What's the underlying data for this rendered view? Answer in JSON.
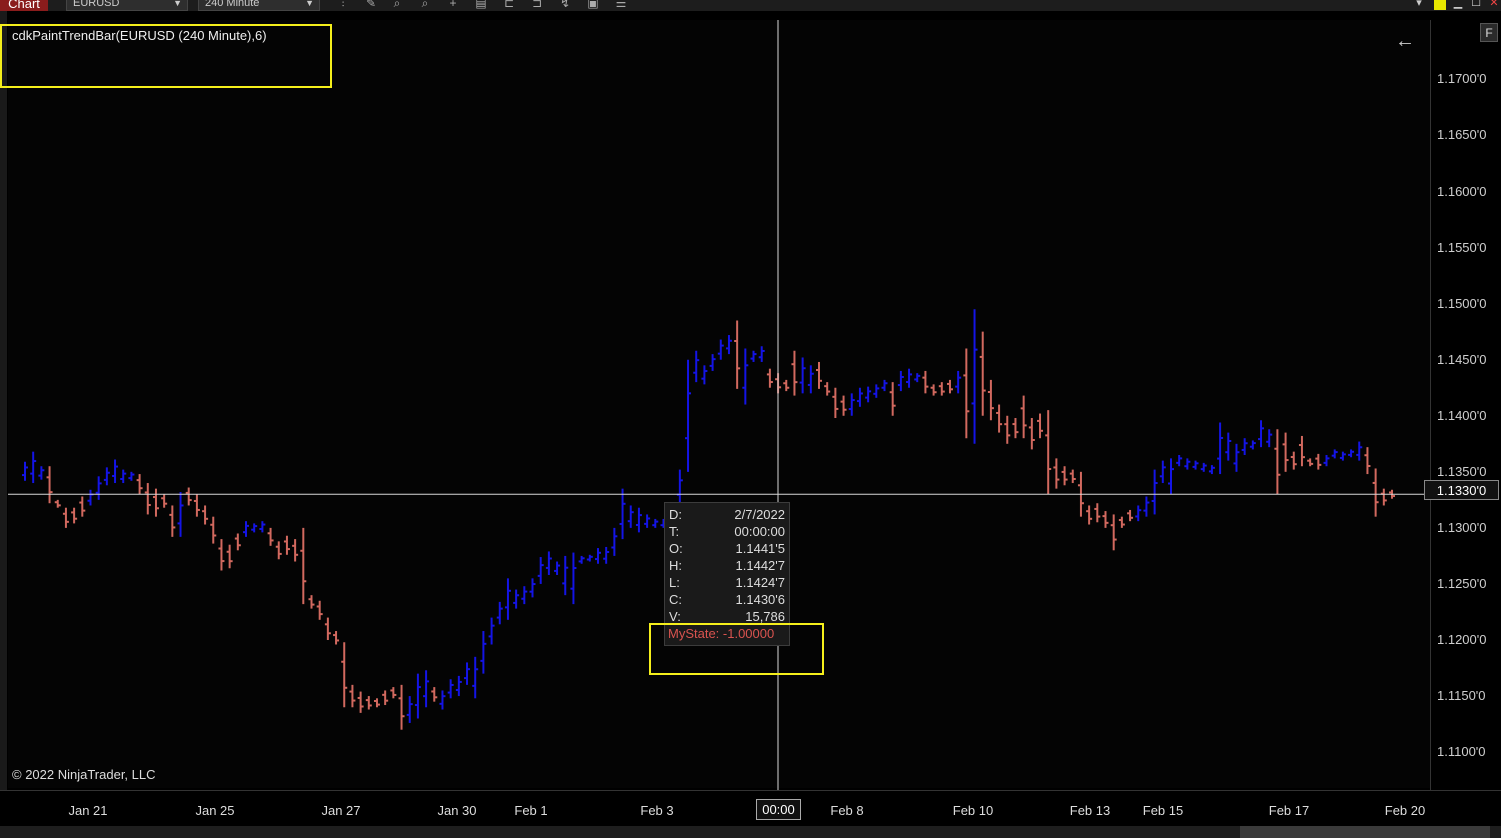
{
  "toolbar": {
    "chart_tab": "Chart",
    "instrument": "EURUSD",
    "interval": "240 Minute"
  },
  "indicator_label": "cdkPaintTrendBar(EURUSD (240 Minute),6)",
  "copyright": "© 2022 NinjaTrader, LLC",
  "f_button": "F",
  "price_badge": "1.1330'0",
  "time_badge": "00:00",
  "tooltip": {
    "rows": [
      {
        "k": "D:",
        "v": "2/7/2022"
      },
      {
        "k": "T:",
        "v": "00:00:00"
      },
      {
        "k": "O:",
        "v": "1.1441'5"
      },
      {
        "k": "H:",
        "v": "1.1442'7"
      },
      {
        "k": "L:",
        "v": "1.1424'7"
      },
      {
        "k": "C:",
        "v": "1.1430'6"
      },
      {
        "k": "V:",
        "v": "15,786"
      }
    ],
    "state": "MyState: -1.00000"
  },
  "colors": {
    "up": "#1414e6",
    "down": "#d2695f",
    "crosshair": "#d8d8d8",
    "highlight": "#f5ef1b"
  },
  "chart_data": {
    "type": "ohlc",
    "instrument": "EURUSD",
    "interval": "240 Minute",
    "y_tick_labels": [
      "1.1700'0",
      "1.1650'0",
      "1.1600'0",
      "1.1550'0",
      "1.1500'0",
      "1.1450'0",
      "1.1400'0",
      "1.1350'0",
      "1.1300'0",
      "1.1250'0",
      "1.1200'0",
      "1.1150'0",
      "1.1100'0"
    ],
    "y_tick_values": [
      1.17,
      1.165,
      1.16,
      1.155,
      1.15,
      1.145,
      1.14,
      1.135,
      1.13,
      1.125,
      1.12,
      1.115,
      1.11
    ],
    "x_tick_labels": [
      "Jan 21",
      "Jan 25",
      "Jan 27",
      "Jan 30",
      "Feb 1",
      "Feb 3",
      "Feb 8",
      "Feb 10",
      "Feb 13",
      "Feb 15",
      "Feb 17",
      "Feb 20"
    ],
    "crosshair_price": 1.133,
    "ylim": [
      1.1068,
      1.1753
    ],
    "bars": [
      {
        "c": "u",
        "h": 1.1359,
        "l": 1.1342
      },
      {
        "c": "u",
        "h": 1.1368,
        "l": 1.134
      },
      {
        "c": "u",
        "h": 1.1355,
        "l": 1.1343
      },
      {
        "c": "d",
        "h": 1.1355,
        "l": 1.1322
      },
      {
        "c": "d",
        "h": 1.1325,
        "l": 1.1318
      },
      {
        "c": "d",
        "h": 1.1318,
        "l": 1.13
      },
      {
        "c": "d",
        "h": 1.1318,
        "l": 1.1304
      },
      {
        "c": "d",
        "h": 1.1328,
        "l": 1.131
      },
      {
        "c": "u",
        "h": 1.1334,
        "l": 1.132
      },
      {
        "c": "u",
        "h": 1.1346,
        "l": 1.1325
      },
      {
        "c": "u",
        "h": 1.1354,
        "l": 1.1338
      },
      {
        "c": "u",
        "h": 1.1361,
        "l": 1.134
      },
      {
        "c": "u",
        "h": 1.1352,
        "l": 1.134
      },
      {
        "c": "u",
        "h": 1.135,
        "l": 1.1342
      },
      {
        "c": "d",
        "h": 1.1348,
        "l": 1.133
      },
      {
        "c": "d",
        "h": 1.134,
        "l": 1.1312
      },
      {
        "c": "d",
        "h": 1.1335,
        "l": 1.131
      },
      {
        "c": "d",
        "h": 1.133,
        "l": 1.1318
      },
      {
        "c": "d",
        "h": 1.132,
        "l": 1.1292
      },
      {
        "c": "u",
        "h": 1.1332,
        "l": 1.1292
      },
      {
        "c": "d",
        "h": 1.1336,
        "l": 1.132
      },
      {
        "c": "d",
        "h": 1.133,
        "l": 1.131
      },
      {
        "c": "d",
        "h": 1.132,
        "l": 1.1303
      },
      {
        "c": "d",
        "h": 1.131,
        "l": 1.1286
      },
      {
        "c": "d",
        "h": 1.129,
        "l": 1.1262
      },
      {
        "c": "d",
        "h": 1.1285,
        "l": 1.1264
      },
      {
        "c": "d",
        "h": 1.1295,
        "l": 1.128
      },
      {
        "c": "u",
        "h": 1.1306,
        "l": 1.1292
      },
      {
        "c": "u",
        "h": 1.1304,
        "l": 1.1296
      },
      {
        "c": "u",
        "h": 1.1306,
        "l": 1.1296
      },
      {
        "c": "d",
        "h": 1.13,
        "l": 1.1284
      },
      {
        "c": "d",
        "h": 1.1288,
        "l": 1.1272
      },
      {
        "c": "d",
        "h": 1.1293,
        "l": 1.1276
      },
      {
        "c": "d",
        "h": 1.129,
        "l": 1.127
      },
      {
        "c": "d",
        "h": 1.13,
        "l": 1.1232
      },
      {
        "c": "d",
        "h": 1.124,
        "l": 1.1228
      },
      {
        "c": "d",
        "h": 1.1235,
        "l": 1.1218
      },
      {
        "c": "d",
        "h": 1.122,
        "l": 1.12
      },
      {
        "c": "d",
        "h": 1.1208,
        "l": 1.1196
      },
      {
        "c": "d",
        "h": 1.1198,
        "l": 1.114
      },
      {
        "c": "d",
        "h": 1.116,
        "l": 1.114
      },
      {
        "c": "d",
        "h": 1.1154,
        "l": 1.1135
      },
      {
        "c": "d",
        "h": 1.115,
        "l": 1.1138
      },
      {
        "c": "d",
        "h": 1.1148,
        "l": 1.114
      },
      {
        "c": "d",
        "h": 1.1155,
        "l": 1.1142
      },
      {
        "c": "d",
        "h": 1.1158,
        "l": 1.1148
      },
      {
        "c": "d",
        "h": 1.116,
        "l": 1.112
      },
      {
        "c": "u",
        "h": 1.115,
        "l": 1.1126
      },
      {
        "c": "u",
        "h": 1.117,
        "l": 1.113
      },
      {
        "c": "u",
        "h": 1.1173,
        "l": 1.114
      },
      {
        "c": "d",
        "h": 1.1158,
        "l": 1.1145
      },
      {
        "c": "u",
        "h": 1.1155,
        "l": 1.1138
      },
      {
        "c": "u",
        "h": 1.1165,
        "l": 1.1148
      },
      {
        "c": "u",
        "h": 1.1168,
        "l": 1.115
      },
      {
        "c": "u",
        "h": 1.118,
        "l": 1.116
      },
      {
        "c": "u",
        "h": 1.1185,
        "l": 1.1148
      },
      {
        "c": "u",
        "h": 1.1208,
        "l": 1.117
      },
      {
        "c": "u",
        "h": 1.122,
        "l": 1.1196
      },
      {
        "c": "u",
        "h": 1.1234,
        "l": 1.1214
      },
      {
        "c": "u",
        "h": 1.1255,
        "l": 1.1218
      },
      {
        "c": "u",
        "h": 1.1245,
        "l": 1.1228
      },
      {
        "c": "u",
        "h": 1.1248,
        "l": 1.1232
      },
      {
        "c": "u",
        "h": 1.1255,
        "l": 1.1238
      },
      {
        "c": "u",
        "h": 1.1274,
        "l": 1.125
      },
      {
        "c": "u",
        "h": 1.1279,
        "l": 1.1258
      },
      {
        "c": "u",
        "h": 1.127,
        "l": 1.1258
      },
      {
        "c": "u",
        "h": 1.1275,
        "l": 1.124
      },
      {
        "c": "u",
        "h": 1.1278,
        "l": 1.1232
      },
      {
        "c": "u",
        "h": 1.1275,
        "l": 1.1268
      },
      {
        "c": "u",
        "h": 1.1276,
        "l": 1.127
      },
      {
        "c": "u",
        "h": 1.1282,
        "l": 1.1268
      },
      {
        "c": "u",
        "h": 1.1283,
        "l": 1.1268
      },
      {
        "c": "u",
        "h": 1.13,
        "l": 1.1275
      },
      {
        "c": "u",
        "h": 1.1335,
        "l": 1.129
      },
      {
        "c": "u",
        "h": 1.132,
        "l": 1.13
      },
      {
        "c": "u",
        "h": 1.1318,
        "l": 1.1296
      },
      {
        "c": "u",
        "h": 1.1312,
        "l": 1.13
      },
      {
        "c": "u",
        "h": 1.1308,
        "l": 1.13
      },
      {
        "c": "u",
        "h": 1.1308,
        "l": 1.13
      },
      {
        "c": "u",
        "h": 1.132,
        "l": 1.13
      },
      {
        "c": "u",
        "h": 1.1352,
        "l": 1.132
      },
      {
        "c": "u",
        "h": 1.145,
        "l": 1.135
      },
      {
        "c": "u",
        "h": 1.1458,
        "l": 1.143
      },
      {
        "c": "u",
        "h": 1.1445,
        "l": 1.1428
      },
      {
        "c": "u",
        "h": 1.1455,
        "l": 1.144
      },
      {
        "c": "u",
        "h": 1.1468,
        "l": 1.145
      },
      {
        "c": "u",
        "h": 1.1472,
        "l": 1.1455
      },
      {
        "c": "d",
        "h": 1.1485,
        "l": 1.1424
      },
      {
        "c": "u",
        "h": 1.146,
        "l": 1.141
      },
      {
        "c": "u",
        "h": 1.1458,
        "l": 1.1448
      },
      {
        "c": "u",
        "h": 1.1462,
        "l": 1.1448
      },
      {
        "c": "d",
        "h": 1.1442,
        "l": 1.1425
      },
      {
        "c": "d",
        "h": 1.1438,
        "l": 1.142
      },
      {
        "c": "d",
        "h": 1.1432,
        "l": 1.1422
      },
      {
        "c": "d",
        "h": 1.1458,
        "l": 1.1418
      },
      {
        "c": "u",
        "h": 1.1452,
        "l": 1.142
      },
      {
        "c": "u",
        "h": 1.1445,
        "l": 1.142
      },
      {
        "c": "d",
        "h": 1.1448,
        "l": 1.1424
      },
      {
        "c": "d",
        "h": 1.143,
        "l": 1.1418
      },
      {
        "c": "d",
        "h": 1.1425,
        "l": 1.1398
      },
      {
        "c": "d",
        "h": 1.1418,
        "l": 1.14
      },
      {
        "c": "u",
        "h": 1.142,
        "l": 1.14
      },
      {
        "c": "u",
        "h": 1.1425,
        "l": 1.1408
      },
      {
        "c": "u",
        "h": 1.1426,
        "l": 1.1412
      },
      {
        "c": "u",
        "h": 1.1428,
        "l": 1.1416
      },
      {
        "c": "u",
        "h": 1.1432,
        "l": 1.1422
      },
      {
        "c": "d",
        "h": 1.143,
        "l": 1.14
      },
      {
        "c": "u",
        "h": 1.144,
        "l": 1.1422
      },
      {
        "c": "u",
        "h": 1.1442,
        "l": 1.1425
      },
      {
        "c": "u",
        "h": 1.1438,
        "l": 1.143
      },
      {
        "c": "d",
        "h": 1.144,
        "l": 1.142
      },
      {
        "c": "d",
        "h": 1.1428,
        "l": 1.1418
      },
      {
        "c": "d",
        "h": 1.143,
        "l": 1.1418
      },
      {
        "c": "d",
        "h": 1.1432,
        "l": 1.142
      },
      {
        "c": "u",
        "h": 1.144,
        "l": 1.142
      },
      {
        "c": "d",
        "h": 1.146,
        "l": 1.138
      },
      {
        "c": "u",
        "h": 1.1495,
        "l": 1.1375
      },
      {
        "c": "d",
        "h": 1.1475,
        "l": 1.14
      },
      {
        "c": "d",
        "h": 1.1432,
        "l": 1.1396
      },
      {
        "c": "d",
        "h": 1.141,
        "l": 1.1385
      },
      {
        "c": "d",
        "h": 1.14,
        "l": 1.1375
      },
      {
        "c": "d",
        "h": 1.1398,
        "l": 1.138
      },
      {
        "c": "d",
        "h": 1.1418,
        "l": 1.138
      },
      {
        "c": "d",
        "h": 1.1398,
        "l": 1.137
      },
      {
        "c": "d",
        "h": 1.1402,
        "l": 1.138
      },
      {
        "c": "d",
        "h": 1.1405,
        "l": 1.133
      },
      {
        "c": "d",
        "h": 1.1362,
        "l": 1.1335
      },
      {
        "c": "d",
        "h": 1.1355,
        "l": 1.1338
      },
      {
        "c": "d",
        "h": 1.1352,
        "l": 1.134
      },
      {
        "c": "d",
        "h": 1.135,
        "l": 1.131
      },
      {
        "c": "d",
        "h": 1.132,
        "l": 1.1303
      },
      {
        "c": "d",
        "h": 1.1322,
        "l": 1.1305
      },
      {
        "c": "d",
        "h": 1.1315,
        "l": 1.13
      },
      {
        "c": "d",
        "h": 1.1312,
        "l": 1.128
      },
      {
        "c": "d",
        "h": 1.131,
        "l": 1.13
      },
      {
        "c": "d",
        "h": 1.1316,
        "l": 1.1306
      },
      {
        "c": "u",
        "h": 1.132,
        "l": 1.1306
      },
      {
        "c": "u",
        "h": 1.1328,
        "l": 1.131
      },
      {
        "c": "u",
        "h": 1.1352,
        "l": 1.1312
      },
      {
        "c": "u",
        "h": 1.136,
        "l": 1.134
      },
      {
        "c": "u",
        "h": 1.1362,
        "l": 1.133
      },
      {
        "c": "u",
        "h": 1.1365,
        "l": 1.1355
      },
      {
        "c": "u",
        "h": 1.1362,
        "l": 1.1352
      },
      {
        "c": "u",
        "h": 1.136,
        "l": 1.1352
      },
      {
        "c": "u",
        "h": 1.1358,
        "l": 1.135
      },
      {
        "c": "u",
        "h": 1.1356,
        "l": 1.1348
      },
      {
        "c": "u",
        "h": 1.1394,
        "l": 1.1348
      },
      {
        "c": "u",
        "h": 1.1385,
        "l": 1.136
      },
      {
        "c": "u",
        "h": 1.1375,
        "l": 1.135
      },
      {
        "c": "u",
        "h": 1.138,
        "l": 1.1365
      },
      {
        "c": "u",
        "h": 1.1378,
        "l": 1.137
      },
      {
        "c": "u",
        "h": 1.1396,
        "l": 1.1372
      },
      {
        "c": "u",
        "h": 1.1388,
        "l": 1.1372
      },
      {
        "c": "d",
        "h": 1.1388,
        "l": 1.133
      },
      {
        "c": "d",
        "h": 1.1385,
        "l": 1.135
      },
      {
        "c": "d",
        "h": 1.1368,
        "l": 1.1352
      },
      {
        "c": "d",
        "h": 1.1382,
        "l": 1.1355
      },
      {
        "c": "d",
        "h": 1.1362,
        "l": 1.1355
      },
      {
        "c": "d",
        "h": 1.1366,
        "l": 1.1352
      },
      {
        "c": "u",
        "h": 1.1365,
        "l": 1.1355
      },
      {
        "c": "u",
        "h": 1.137,
        "l": 1.1362
      },
      {
        "c": "u",
        "h": 1.1368,
        "l": 1.136
      },
      {
        "c": "u",
        "h": 1.137,
        "l": 1.1363
      },
      {
        "c": "u",
        "h": 1.1377,
        "l": 1.136
      },
      {
        "c": "d",
        "h": 1.1372,
        "l": 1.1348
      },
      {
        "c": "d",
        "h": 1.1353,
        "l": 1.131
      },
      {
        "c": "d",
        "h": 1.1335,
        "l": 1.132
      },
      {
        "c": "d",
        "h": 1.1334,
        "l": 1.1326
      }
    ]
  }
}
